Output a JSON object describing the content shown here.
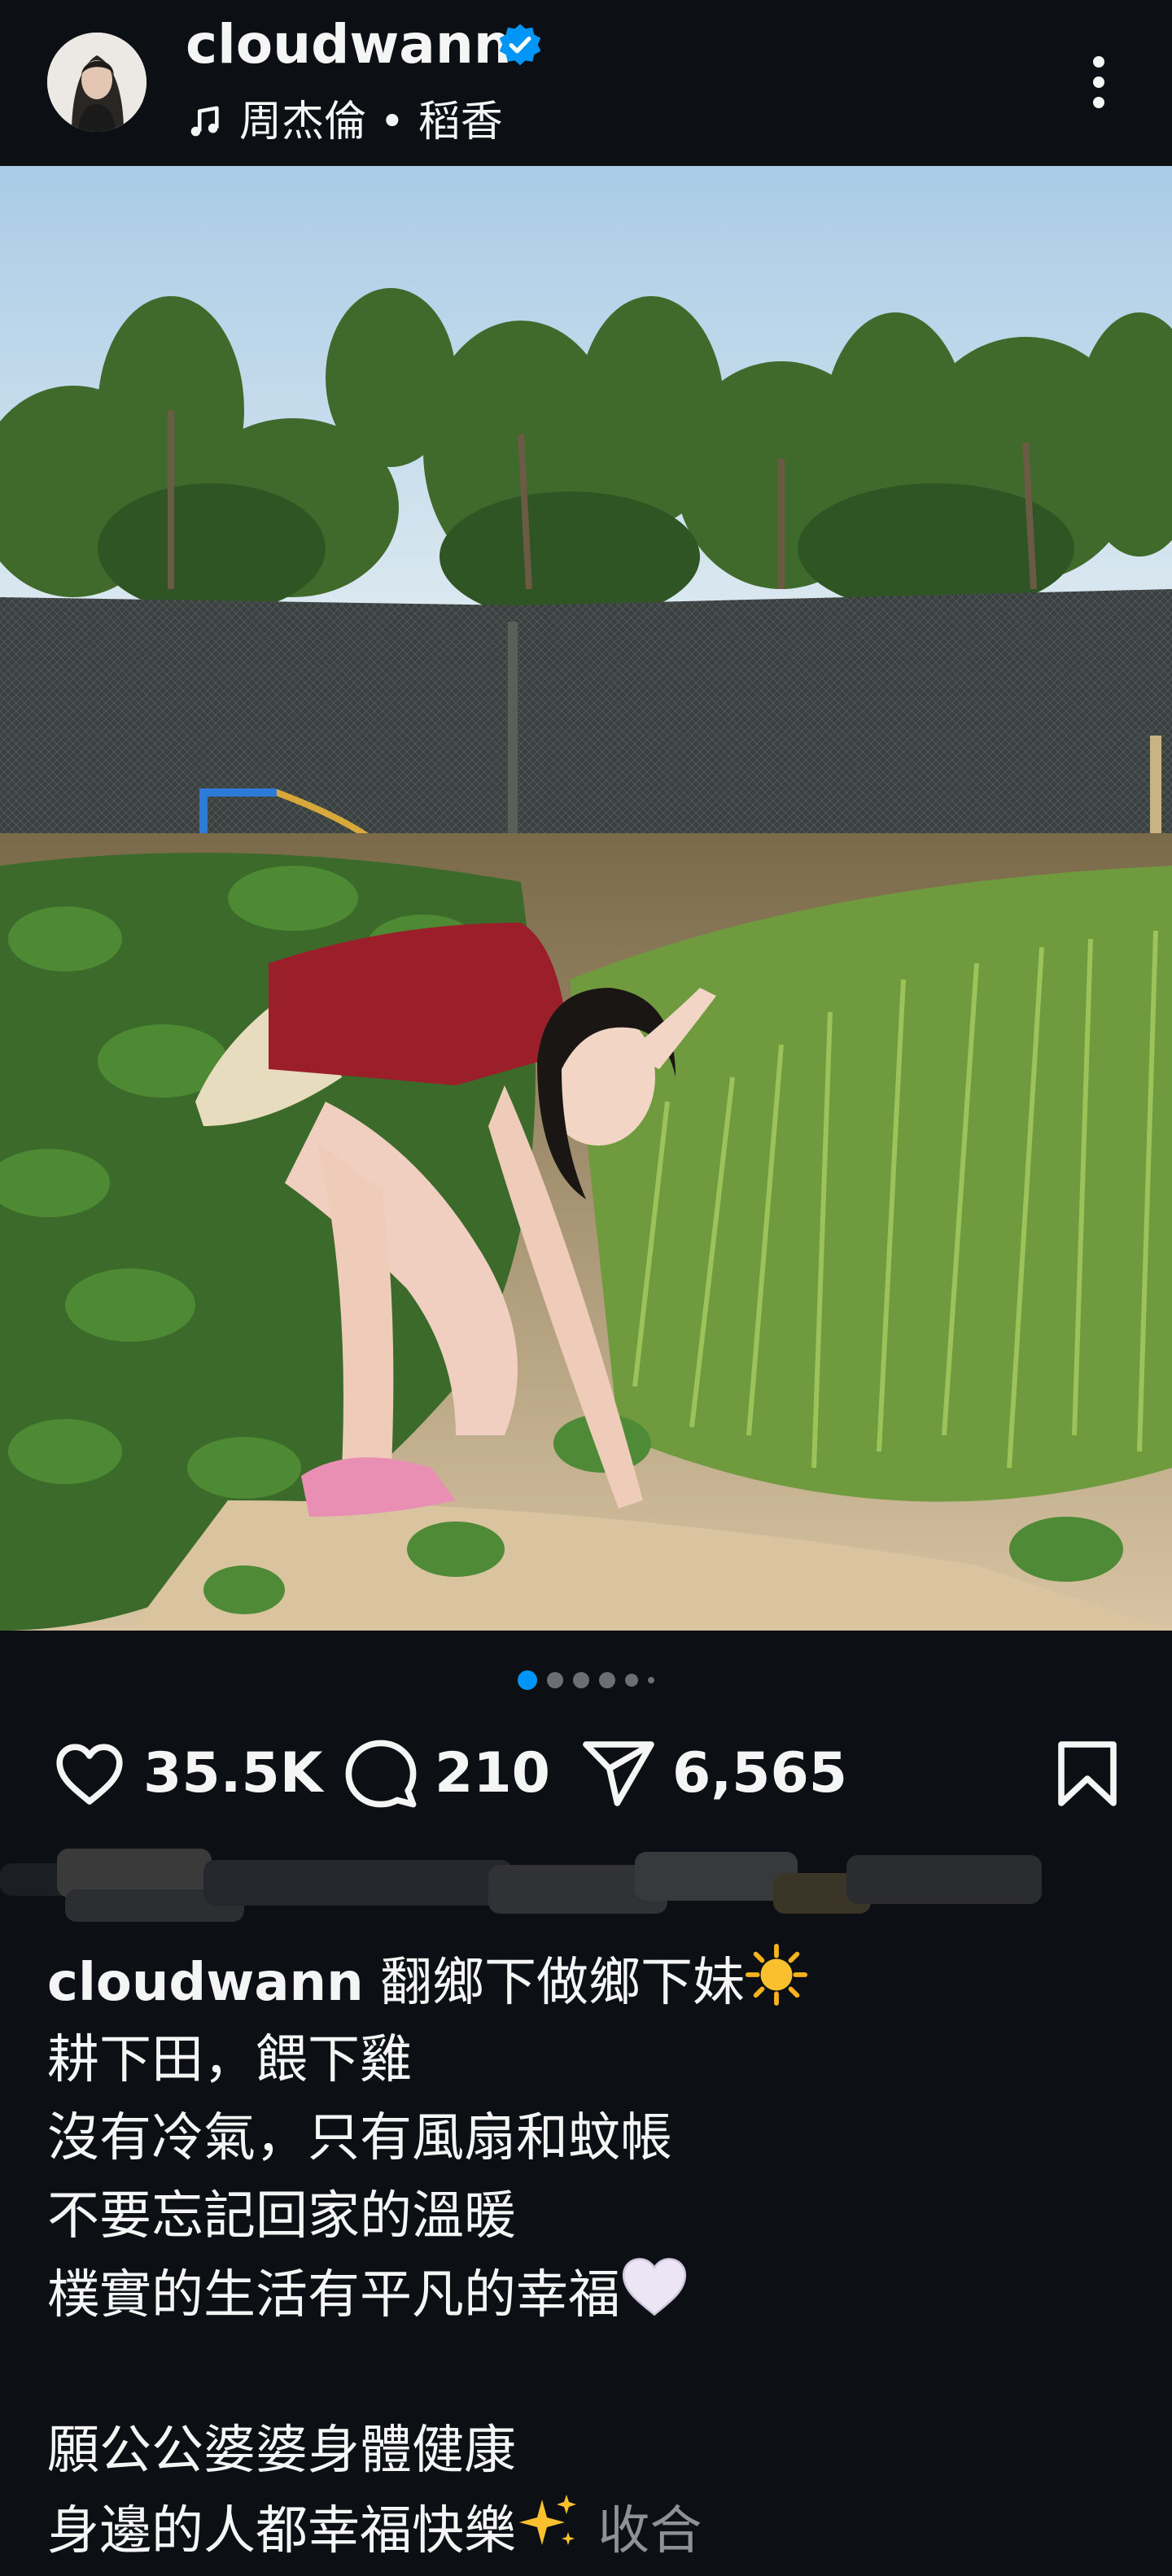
{
  "header": {
    "username": "cloudwann",
    "music": "周杰倫 • 稻香"
  },
  "post": {
    "carousel_count": 6,
    "carousel_active": 1
  },
  "actions": {
    "likes": "35.5K",
    "comments": "210",
    "shares": "6,565"
  },
  "caption": {
    "username": "cloudwann",
    "line1": "翻鄉下做鄉下妹",
    "line2": "耕下田，餵下雞",
    "line3": "沒有冷氣，只有風扇和蚊帳",
    "line4": "不要忘記回家的溫暖",
    "line5": "樸實的生活有平凡的幸福",
    "line6": "願公公婆婆身體健康",
    "line7": "身邊的人都幸福快樂",
    "more_label": "收合"
  },
  "colors": {
    "background": "#0c1014",
    "accent": "#0095f6",
    "muted_text": "#8e9196"
  }
}
